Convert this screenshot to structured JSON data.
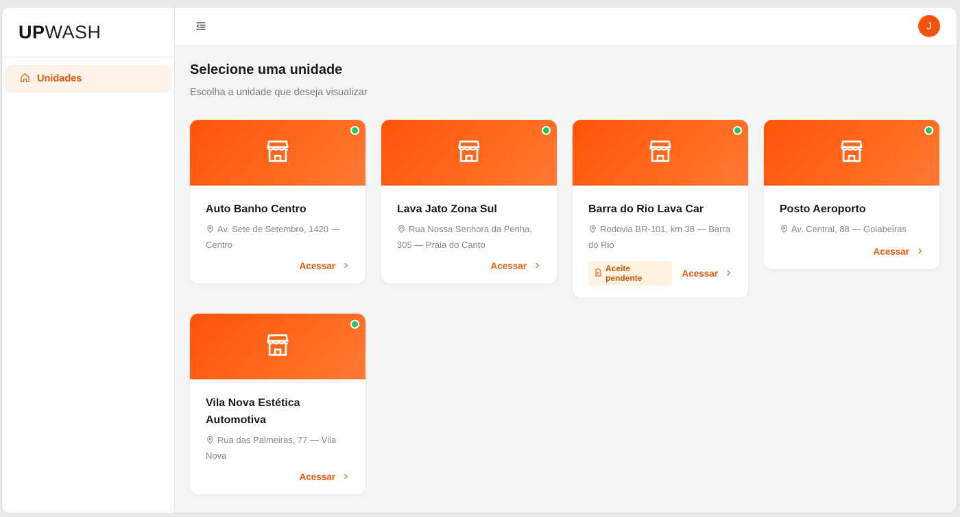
{
  "app": {
    "logo_bold": "UP",
    "logo_light": "WASH"
  },
  "sidebar": {
    "items": [
      {
        "label": "Unidades",
        "icon": "home-icon"
      }
    ]
  },
  "topbar": {
    "menu_icon": "menu-collapse-icon",
    "avatar_initial": "J"
  },
  "page": {
    "title": "Selecione uma unidade",
    "subtitle": "Escolha a unidade que deseja visualizar"
  },
  "colors": {
    "accent": "#ea580c",
    "banner": "#ff5a10",
    "status_online": "#22c55e"
  },
  "units": [
    {
      "name": "Auto Banho Centro",
      "address": "Av. Sete de Setembro, 1420 — Centro",
      "badge": "",
      "action": "Acessar",
      "status": "online"
    },
    {
      "name": "Lava Jato Zona Sul",
      "address": "Rua Nossa Senhora da Penha, 305 — Praia do Canto",
      "badge": "",
      "action": "Acessar",
      "status": "online"
    },
    {
      "name": "Barra do Rio Lava Car",
      "address": "Rodovia BR-101, km 38 — Barra do Rio",
      "badge": "Aceite pendente",
      "action": "Acessar",
      "status": "online"
    },
    {
      "name": "Posto Aeroporto",
      "address": "Av. Central, 88 — Goiabeiras",
      "badge": "",
      "action": "Acessar",
      "status": "online"
    },
    {
      "name": "Vila Nova Estética Automotiva",
      "address": "Rua das Palmeiras, 77 — Vila Nova",
      "badge": "",
      "action": "Acessar",
      "status": "online"
    }
  ]
}
